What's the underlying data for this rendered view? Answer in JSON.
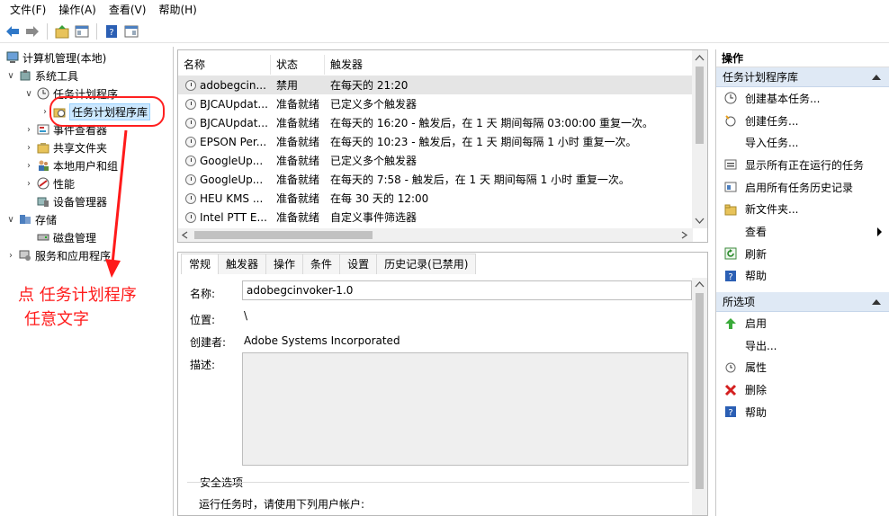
{
  "menu": [
    "文件(F)",
    "操作(A)",
    "查看(V)",
    "帮助(H)"
  ],
  "tree": {
    "root": "计算机管理(本地)",
    "system_tools": "系统工具",
    "task_scheduler": "任务计划程序",
    "task_scheduler_library": "任务计划程序库",
    "event_viewer": "事件查看器",
    "shared_folders": "共享文件夹",
    "local_users": "本地用户和组",
    "performance": "性能",
    "device_manager": "设备管理器",
    "storage": "存储",
    "disk_management": "磁盘管理",
    "services_apps": "服务和应用程序"
  },
  "annotation": {
    "line1": "点 任务计划程序",
    "line2": "任意文字",
    "color": "#ff1a1a"
  },
  "task_list": {
    "columns": [
      "名称",
      "状态",
      "触发器"
    ],
    "rows": [
      {
        "name": "adobegcin...",
        "status": "禁用",
        "trigger": "在每天的 21:20"
      },
      {
        "name": "BJCAUpdat...",
        "status": "准备就绪",
        "trigger": "已定义多个触发器"
      },
      {
        "name": "BJCAUpdat...",
        "status": "准备就绪",
        "trigger": "在每天的 16:20 - 触发后，在 1 天 期间每隔 03:00:00 重复一次。"
      },
      {
        "name": "EPSON Per...",
        "status": "准备就绪",
        "trigger": "在每天的 10:23 - 触发后，在 1 天 期间每隔 1 小时 重复一次。"
      },
      {
        "name": "GoogleUp...",
        "status": "准备就绪",
        "trigger": "已定义多个触发器"
      },
      {
        "name": "GoogleUp...",
        "status": "准备就绪",
        "trigger": "在每天的 7:58 - 触发后，在 1 天 期间每隔 1 小时 重复一次。"
      },
      {
        "name": "HEU KMS ...",
        "status": "准备就绪",
        "trigger": "在每 30 天的 12:00"
      },
      {
        "name": "Intel PTT E...",
        "status": "准备就绪",
        "trigger": "自定义事件筛选器"
      }
    ]
  },
  "detail": {
    "tabs": [
      "常规",
      "触发器",
      "操作",
      "条件",
      "设置",
      "历史记录(已禁用)"
    ],
    "name_label": "名称:",
    "name_value": "adobegcinvoker-1.0",
    "location_label": "位置:",
    "location_value": "\\",
    "author_label": "创建者:",
    "author_value": "Adobe Systems Incorporated",
    "description_label": "描述:",
    "security_label": "安全选项",
    "run_as_label": "运行任务时，请使用下列用户帐户:"
  },
  "actions": {
    "title": "操作",
    "section1": "任务计划程序库",
    "items1": [
      "创建基本任务...",
      "创建任务...",
      "导入任务...",
      "显示所有正在运行的任务",
      "启用所有任务历史记录",
      "新文件夹...",
      "查看",
      "刷新",
      "帮助"
    ],
    "section2": "所选项",
    "items2": [
      "启用",
      "导出...",
      "属性",
      "删除",
      "帮助"
    ]
  }
}
